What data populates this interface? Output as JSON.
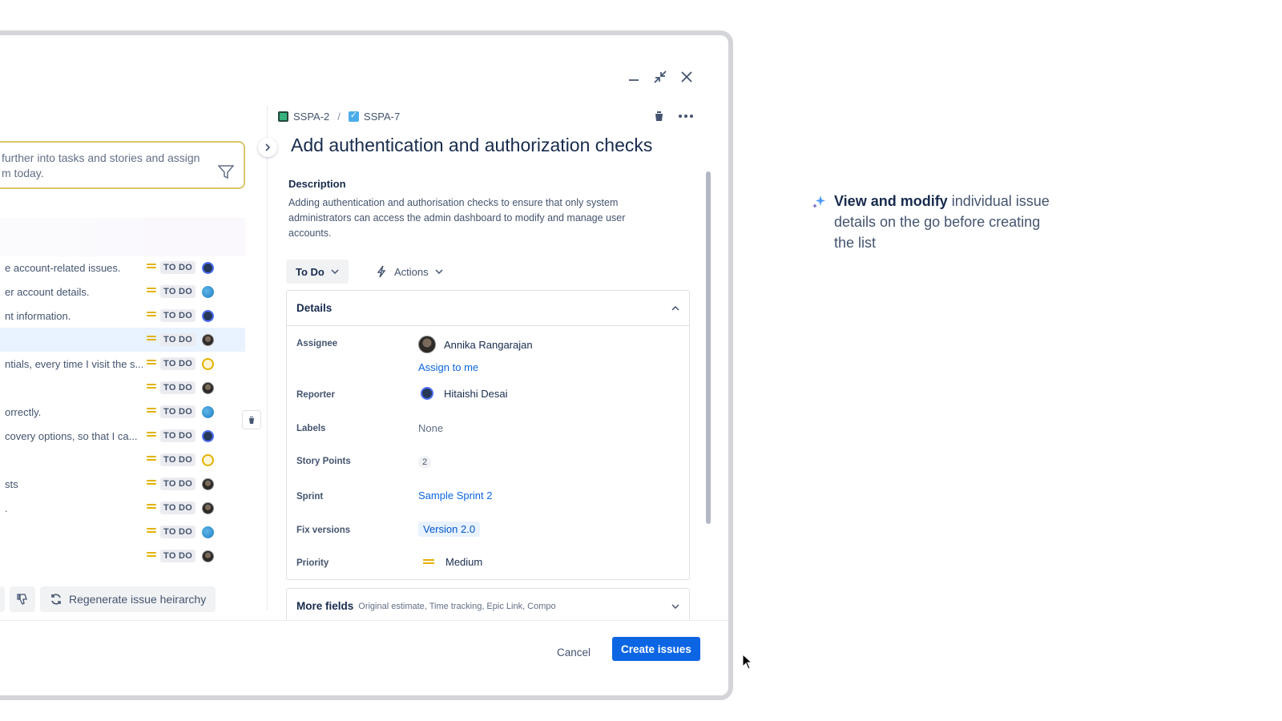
{
  "prompt": {
    "text_line1": "further into tasks and stories and assign",
    "text_line2": "m today."
  },
  "issues": [
    {
      "summary": "e account-related issues.",
      "status": "TO DO",
      "avatar": "hd"
    },
    {
      "summary": "er account details.",
      "status": "TO DO",
      "avatar": "globe"
    },
    {
      "summary": "nt information.",
      "status": "TO DO",
      "avatar": "hd"
    },
    {
      "summary": "",
      "status": "TO DO",
      "avatar": "photo",
      "selected": true
    },
    {
      "summary": "ntials, every time I visit the s...",
      "status": "TO DO",
      "avatar": "yellow"
    },
    {
      "summary": "",
      "status": "TO DO",
      "avatar": "photo"
    },
    {
      "summary": "orrectly.",
      "status": "TO DO",
      "avatar": "globe"
    },
    {
      "summary": "covery options, so that I ca...",
      "status": "TO DO",
      "avatar": "hd"
    },
    {
      "summary": "",
      "status": "TO DO",
      "avatar": "yellow"
    },
    {
      "summary": "sts",
      "status": "TO DO",
      "avatar": "photo"
    },
    {
      "summary": ".",
      "status": "TO DO",
      "avatar": "photo"
    },
    {
      "summary": "",
      "status": "TO DO",
      "avatar": "globe"
    },
    {
      "summary": "",
      "status": "TO DO",
      "avatar": "photo"
    }
  ],
  "left_footer": {
    "regenerate_label": "Regenerate issue heirarchy"
  },
  "breadcrumb": {
    "parent": "SSPA-2",
    "separator": "/",
    "current": "SSPA-7"
  },
  "issue": {
    "title": "Add authentication and authorization checks",
    "description_heading": "Description",
    "description": "Adding authentication and authorisation checks to ensure that only system administrators can access the admin dashboard to modify and manage user accounts.",
    "status_label": "To Do",
    "actions_label": "Actions"
  },
  "details": {
    "heading": "Details",
    "assignee_label": "Assignee",
    "assignee": "Annika Rangarajan",
    "assign_to_me": "Assign to me",
    "reporter_label": "Reporter",
    "reporter": "Hitaishi Desai",
    "labels_label": "Labels",
    "labels": "None",
    "story_points_label": "Story Points",
    "story_points": "2",
    "sprint_label": "Sprint",
    "sprint": "Sample Sprint 2",
    "fix_versions_label": "Fix versions",
    "fix_version": "Version 2.0",
    "priority_label": "Priority",
    "priority": "Medium"
  },
  "more_fields": {
    "heading": "More fields",
    "subtitle": "Original estimate, Time tracking, Epic Link, Compo"
  },
  "footer": {
    "cancel_label": "Cancel",
    "create_label": "Create issues"
  },
  "caption": {
    "bold": "View and modify",
    "rest": " individual issue details on the go before creating the list"
  },
  "colors": {
    "primary": "#0c66e4",
    "priority_medium": "#e2b203",
    "selected_row": "#e9f2ff"
  }
}
